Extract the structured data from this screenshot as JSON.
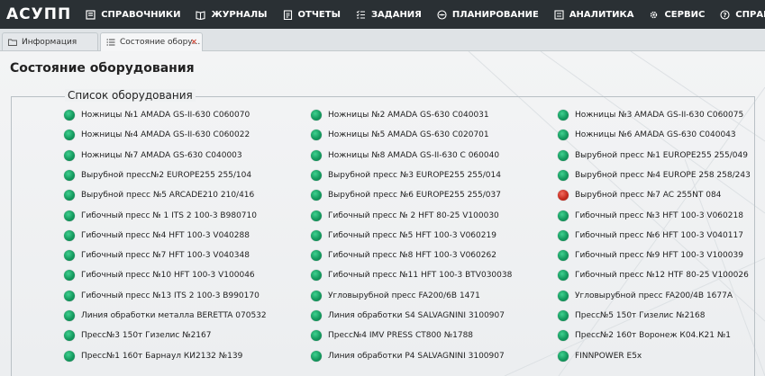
{
  "app": {
    "brand": "АСУПП"
  },
  "nav": [
    {
      "label": "СПРАВОЧНИКИ",
      "icon": "directory-icon"
    },
    {
      "label": "ЖУРНАЛЫ",
      "icon": "book-icon"
    },
    {
      "label": "ОТЧЕТЫ",
      "icon": "report-icon"
    },
    {
      "label": "ЗАДАНИЯ",
      "icon": "task-list-icon"
    },
    {
      "label": "ПЛАНИРОВАНИЕ",
      "icon": "compass-icon"
    },
    {
      "label": "АНАЛИТИКА",
      "icon": "analytics-icon"
    },
    {
      "label": "СЕРВИС",
      "icon": "gear-icon"
    },
    {
      "label": "СПРАВКА",
      "icon": "help-icon"
    }
  ],
  "tabs": [
    {
      "label": "Информация",
      "icon": "info-folder-icon",
      "active": false
    },
    {
      "label": "Состояние обору...",
      "icon": "list-icon",
      "active": true,
      "close": "×"
    }
  ],
  "page": {
    "title": "Состояние оборудования",
    "group_title": "Список оборудования"
  },
  "colors": {
    "ok": "#14995e",
    "fault": "#c62c20",
    "nav_bg": "#2a3034"
  },
  "equipment": {
    "col1": [
      {
        "name": "Ножницы №1 AMADA GS-II-630 C060070",
        "status": "ok"
      },
      {
        "name": "Ножницы №4 AMADA GS-II-630 C060022",
        "status": "ok"
      },
      {
        "name": "Ножницы №7 AMADA GS-630 C040003",
        "status": "ok"
      },
      {
        "name": "Вырубной пресс№2 EUROPE255 255/104",
        "status": "ok"
      },
      {
        "name": "Вырубной пресс №5 ARCADE210 210/416",
        "status": "ok"
      },
      {
        "name": "Гибочный пресс № 1 ITS 2 100-3 B980710",
        "status": "ok"
      },
      {
        "name": "Гибочный пресс №4 HFT 100-3 V040288",
        "status": "ok"
      },
      {
        "name": "Гибочный пресс №7 HFT 100-3 V040348",
        "status": "ok"
      },
      {
        "name": "Гибочный пресс №10 HFT 100-3 V100046",
        "status": "ok"
      },
      {
        "name": "Гибочный пресс №13 ITS 2 100-3 B990170",
        "status": "ok"
      },
      {
        "name": "Линия обработки металла BERETTA 070532",
        "status": "ok"
      },
      {
        "name": "Пресс№3 150т Гизелис №2167",
        "status": "ok"
      },
      {
        "name": "Пресс№1 160т Барнаул КИ2132 №139",
        "status": "ok"
      }
    ],
    "col2": [
      {
        "name": "Ножницы №2 AMADA GS-630 C040031",
        "status": "ok"
      },
      {
        "name": "Ножницы №5 AMADA GS-630 C020701",
        "status": "ok"
      },
      {
        "name": "Ножницы №8 AMADA GS-II-630 C 060040",
        "status": "ok"
      },
      {
        "name": "Вырубной пресс №3 EUROPE255 255/014",
        "status": "ok"
      },
      {
        "name": "Вырубной пресс №6 EUROPE255 255/037",
        "status": "ok"
      },
      {
        "name": "Гибочный пресс № 2 HFT 80-25 V100030",
        "status": "ok"
      },
      {
        "name": "Гибочный пресс №5 HFT 100-3 V060219",
        "status": "ok"
      },
      {
        "name": "Гибочный пресс №8 HFT 100-3 V060262",
        "status": "ok"
      },
      {
        "name": "Гибочный пресс №11 HFT 100-3 BTV030038",
        "status": "ok"
      },
      {
        "name": "Угловырубной пресс FA200/6B 1471",
        "status": "ok"
      },
      {
        "name": "Линия обработки S4 SALVAGNINI 3100907",
        "status": "ok"
      },
      {
        "name": "Пресс№4 IMV PRESS CT800 №1788",
        "status": "ok"
      },
      {
        "name": "Линия обработки P4 SALVAGNINI 3100907",
        "status": "ok"
      }
    ],
    "col3": [
      {
        "name": "Ножницы №3 AMADA GS-II-630 C060075",
        "status": "ok"
      },
      {
        "name": "Ножницы №6 AMADA GS-630 C040043",
        "status": "ok"
      },
      {
        "name": "Вырубной пресс №1 EUROPE255 255/049",
        "status": "ok"
      },
      {
        "name": "Вырубной пресс №4 EUROPE 258 258/243",
        "status": "ok"
      },
      {
        "name": "Вырубной пресс №7 AC 255NT 084",
        "status": "fault"
      },
      {
        "name": "Гибочный пресс №3 HFT 100-3 V060218",
        "status": "ok"
      },
      {
        "name": "Гибочный пресс №6 HFT 100-3 V040117",
        "status": "ok"
      },
      {
        "name": "Гибочный пресс №9 HFT 100-3 V100039",
        "status": "ok"
      },
      {
        "name": "Гибочный пресс №12 HTF 80-25 V100026",
        "status": "ok"
      },
      {
        "name": "Угловырубной пресс FA200/4B 1677A",
        "status": "ok"
      },
      {
        "name": "Пресс№5 150т Гизелис №2168",
        "status": "ok"
      },
      {
        "name": "Пресс№2 160т Воронеж К04.К21 №1",
        "status": "ok"
      },
      {
        "name": "FINNPOWER E5x",
        "status": "ok"
      }
    ]
  }
}
